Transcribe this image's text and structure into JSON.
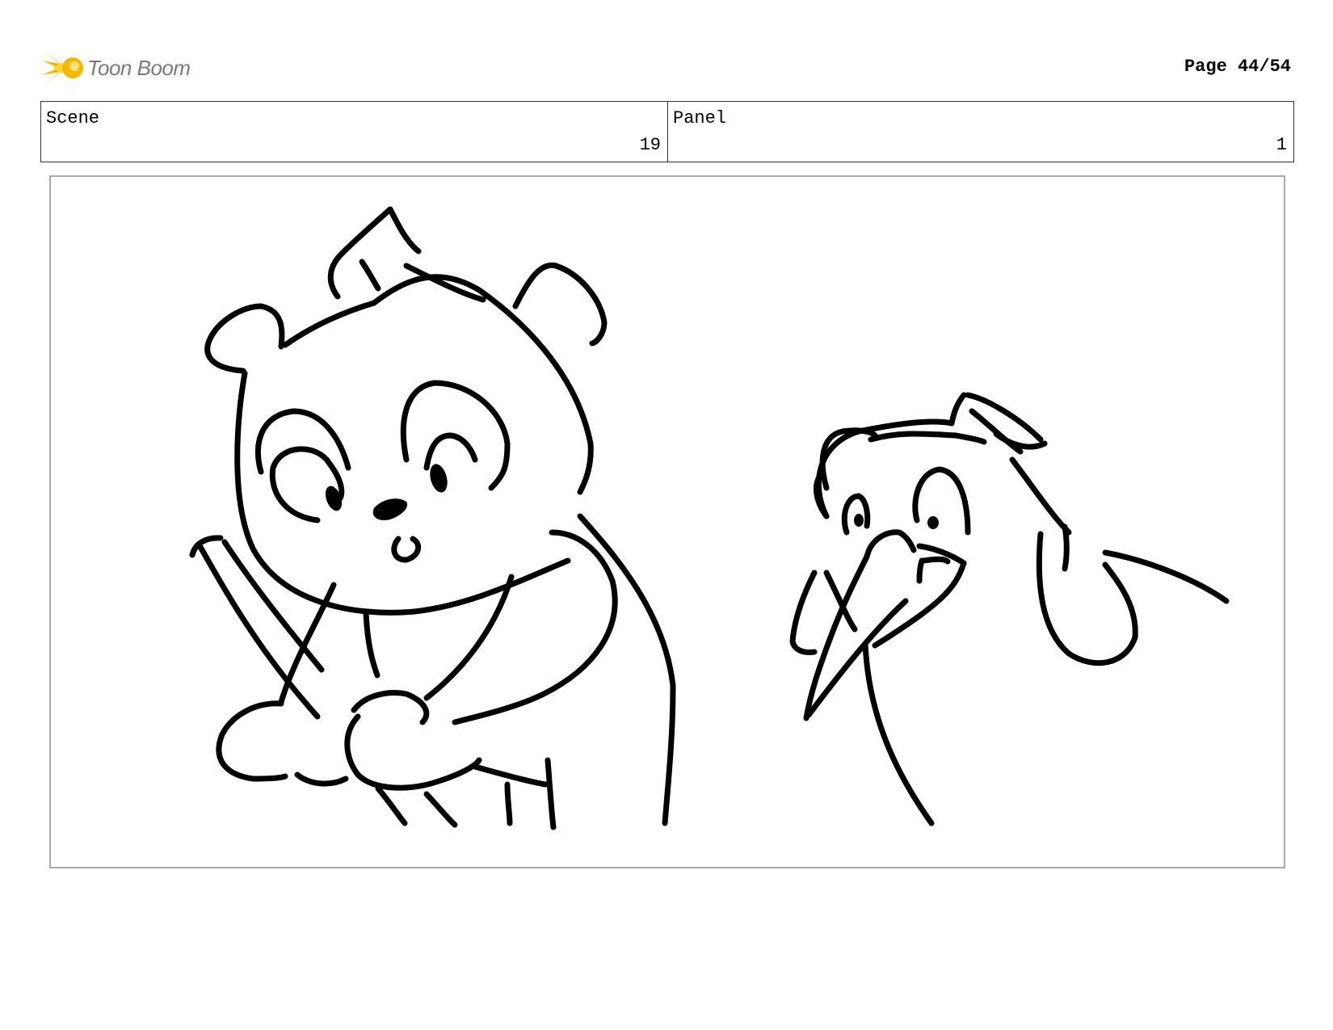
{
  "header": {
    "logo_text": "Toon Boom",
    "logo_accent_color": "#f5b800",
    "page_label": "Page 44/54"
  },
  "info": {
    "scene_label": "Scene",
    "scene_value": "19",
    "panel_label": "Panel",
    "panel_value": "1"
  },
  "drawing": {
    "characters": [
      "bear-holding-stick",
      "bird"
    ],
    "line_color": "#000000"
  }
}
